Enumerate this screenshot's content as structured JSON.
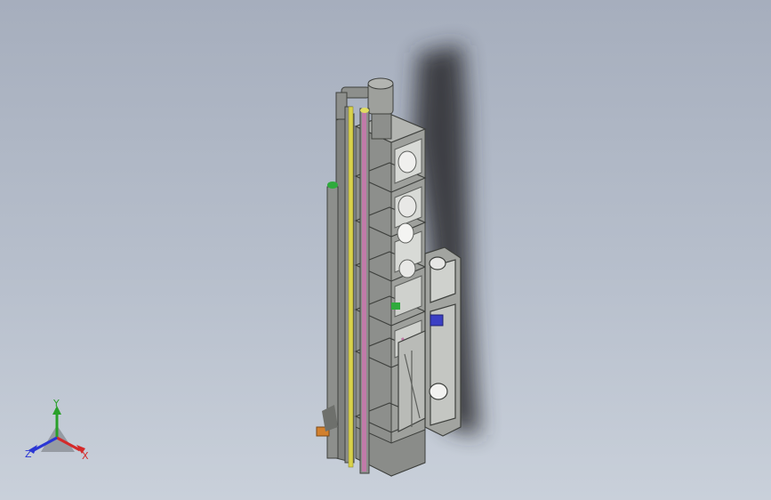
{
  "viewport": {
    "background_top": "#a6aebd",
    "background_bottom": "#c9d0da"
  },
  "model": {
    "description_icon": "tower-plant-3d-model",
    "steel_color": "#8d8f8c",
    "steel_dark": "#5e605d",
    "steel_light": "#b3b5b1",
    "shadow_color": "#2a2c2e",
    "pipe_yellow": "#d9d24a",
    "pipe_pink": "#c07aa8",
    "pipe_blue": "#3b3fc4",
    "accent_orange": "#d2802e",
    "accent_green": "#2faa3c"
  },
  "triad": {
    "x_label": "X",
    "y_label": "Y",
    "z_label": "Z",
    "x_color": "#d42a2a",
    "y_color": "#2aa02a",
    "z_color": "#2a36d4"
  }
}
